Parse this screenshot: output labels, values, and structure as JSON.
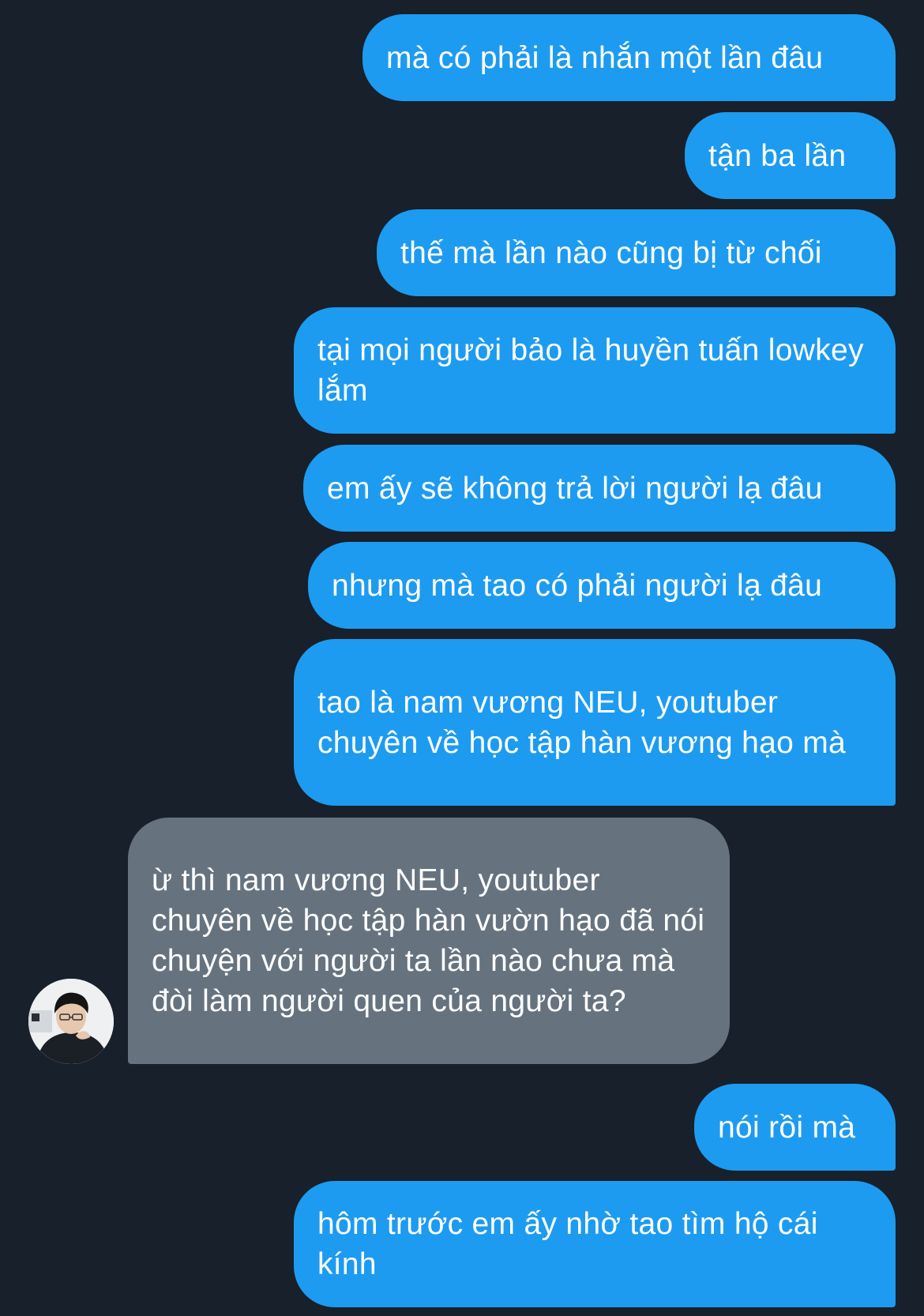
{
  "messages": [
    {
      "direction": "sent",
      "text": "mà có phải là nhắn một lần đâu"
    },
    {
      "direction": "sent",
      "text": "tận ba lần"
    },
    {
      "direction": "sent",
      "text": "thế mà lần nào cũng bị từ chối"
    },
    {
      "direction": "sent",
      "text": "tại mọi người bảo là huyền tuấn lowkey lắm"
    },
    {
      "direction": "sent",
      "text": "em ấy sẽ không trả lời người lạ đâu"
    },
    {
      "direction": "sent",
      "text": "nhưng mà tao có phải người lạ đâu"
    },
    {
      "direction": "sent",
      "text": "tao là nam vương NEU, youtuber chuyên về học tập hàn vương hạo mà"
    },
    {
      "direction": "received",
      "text": "ừ thì nam vương NEU, youtuber chuyên về học tập hàn vườn hạo đã nói chuyện với người ta lần nào chưa mà đòi làm người quen của người ta?"
    },
    {
      "direction": "sent",
      "text": "nói rồi mà"
    },
    {
      "direction": "sent",
      "text": "hôm trước em ấy nhờ tao tìm hộ cái kính"
    }
  ],
  "contact": {
    "avatar": "contact-avatar-photo"
  },
  "colors": {
    "background": "#17202b",
    "sent_bubble": "#1d9bf0",
    "received_bubble": "#66737f",
    "text": "#ffffff"
  }
}
